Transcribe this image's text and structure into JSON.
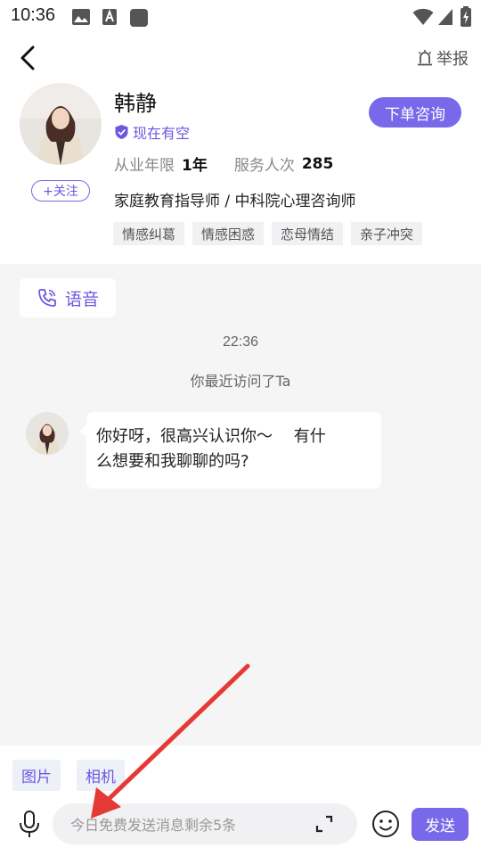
{
  "status_bar": {
    "time": "10:36",
    "icons": [
      "gallery-icon",
      "a-box-icon",
      "app-square-icon",
      "wifi-icon",
      "signal-icon",
      "battery-charging-icon"
    ]
  },
  "header": {
    "report_label": "举报"
  },
  "consultant": {
    "name": "韩静",
    "availability": "现在有空",
    "follow_label": "+关注",
    "order_button": "下单咨询",
    "experience_label": "从业年限",
    "experience_value": "1年",
    "service_label": "服务人次",
    "service_value": "285",
    "title": "家庭教育指导师 / 中科院心理咨询师",
    "tags": [
      "情感纠葛",
      "情感困惑",
      "恋母情结",
      "亲子冲突"
    ]
  },
  "chat": {
    "voice_label": "语音",
    "time": "22:36",
    "notice": "你最近访问了Ta",
    "message_line1": "你好呀，很高兴认识你～　  有什",
    "message_line2": "么想要和我聊聊的吗?"
  },
  "composer": {
    "image_label": "图片",
    "camera_label": "相机",
    "placeholder": "今日免费发送消息剩余5条",
    "send_label": "发送"
  },
  "colors": {
    "accent": "#7a68ea",
    "chat_background": "#f5f5f5",
    "annotation_arrow": "#e53935"
  }
}
